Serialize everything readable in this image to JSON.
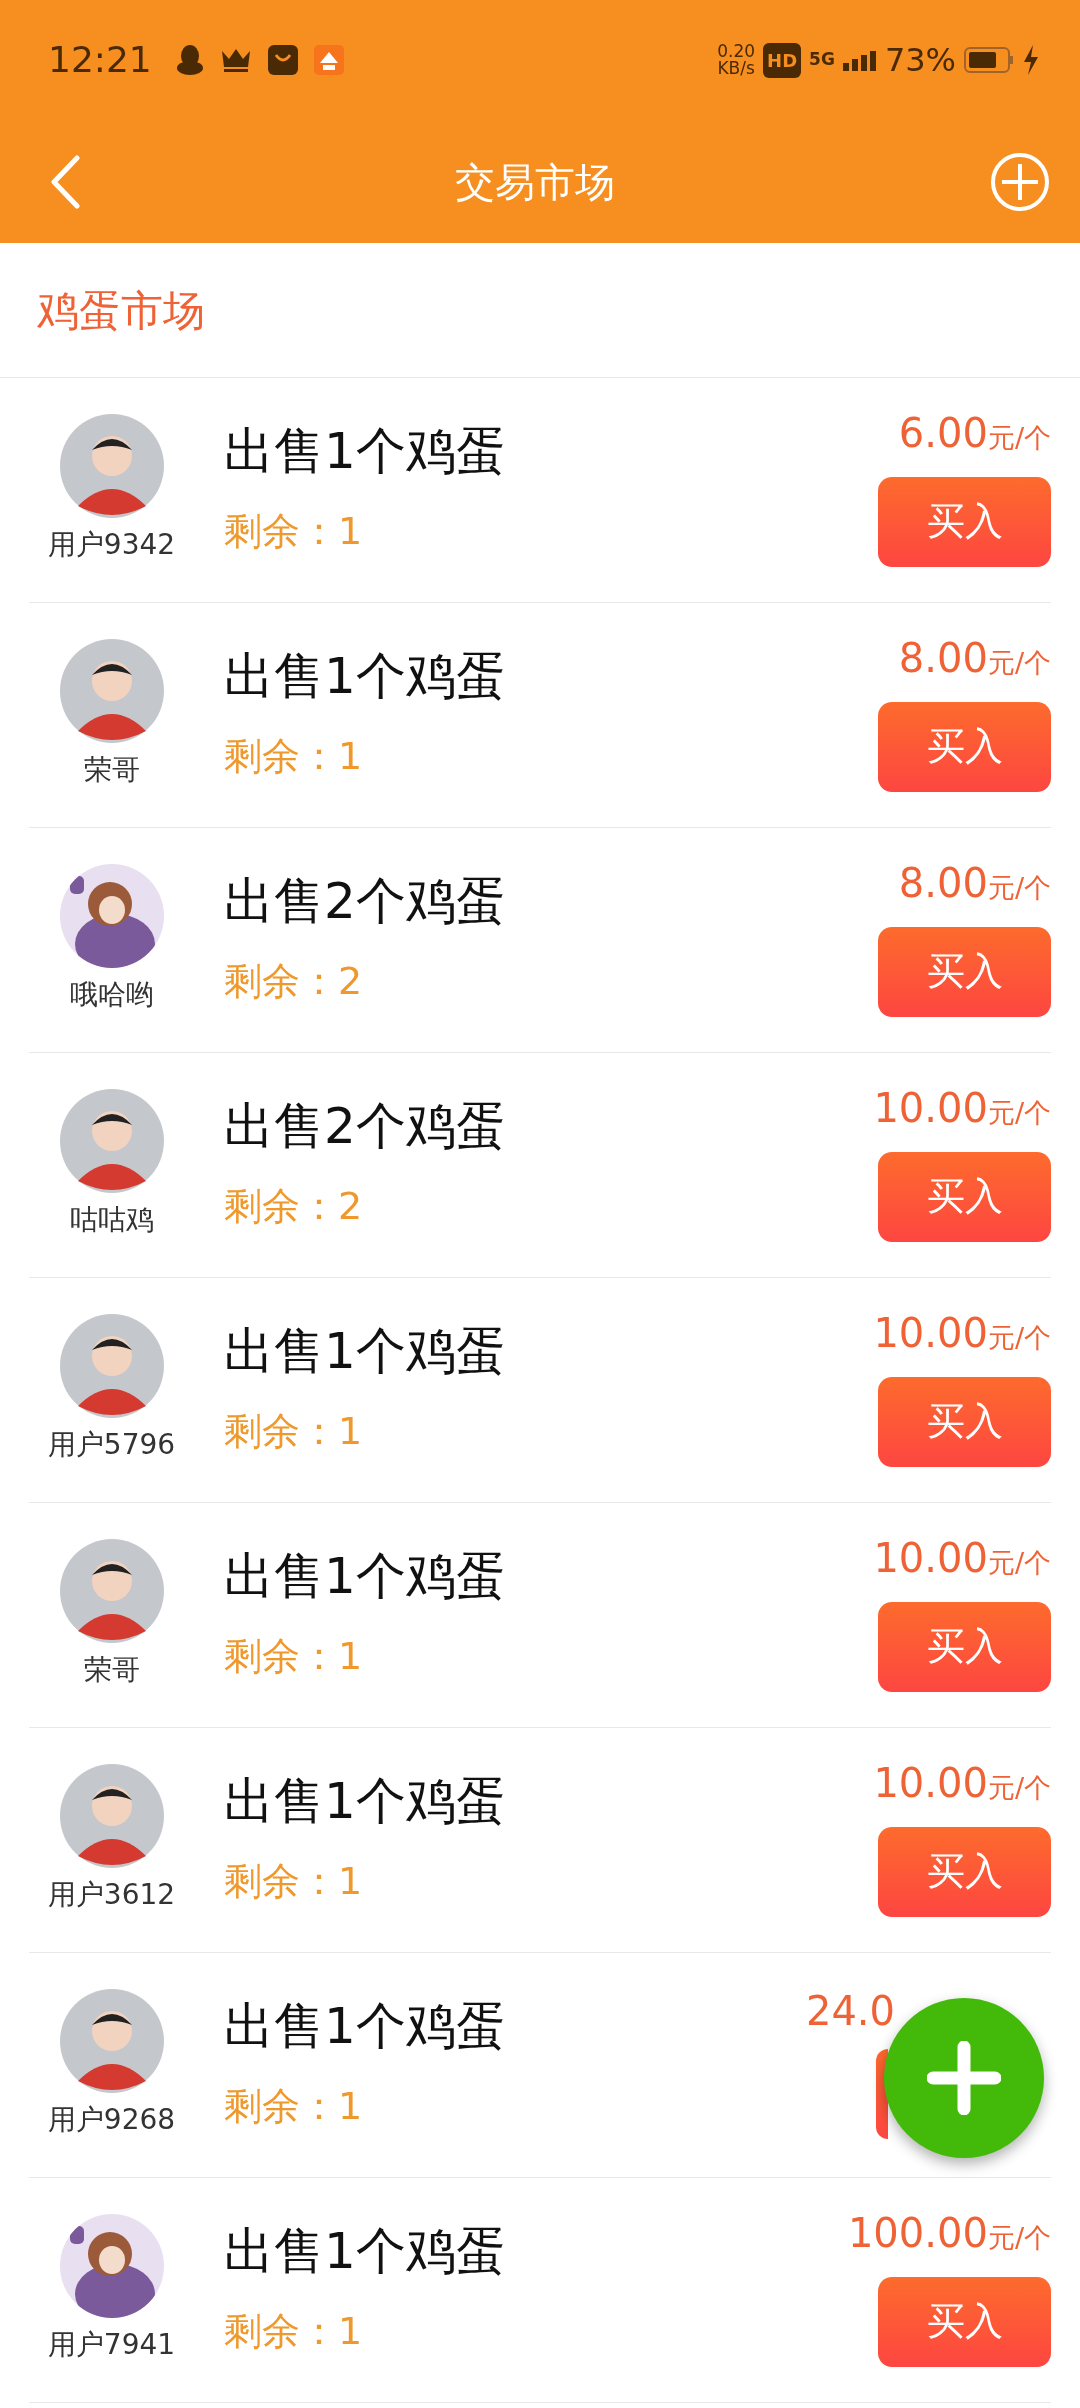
{
  "status_bar": {
    "time": "12:21",
    "speed": "0.20",
    "speed_unit": "KB/s",
    "hd": "HD",
    "network": "5G",
    "battery": "73%"
  },
  "header": {
    "title": "交易市场"
  },
  "section_title": "鸡蛋市场",
  "listings": [
    {
      "user": "用户9342",
      "avatar": {
        "kind": "default"
      },
      "title": "出售1个鸡蛋",
      "remaining": "剩余：1",
      "price": "6.00",
      "unit": "元/个",
      "button": "买入"
    },
    {
      "user": "荣哥",
      "avatar": {
        "kind": "default"
      },
      "title": "出售1个鸡蛋",
      "remaining": "剩余：1",
      "price": "8.00",
      "unit": "元/个",
      "button": "买入"
    },
    {
      "user": "哦哈哟",
      "title": "出售2个鸡蛋",
      "remaining": "剩余：2",
      "price": "8.00",
      "unit": "元/个",
      "button": "买入"
    },
    {
      "user": "咕咕鸡",
      "avatar": {
        "kind": "default"
      },
      "title": "出售2个鸡蛋",
      "remaining": "剩余：2",
      "price": "10.00",
      "unit": "元/个",
      "button": "买入"
    },
    {
      "user": "用户5796",
      "avatar": {
        "kind": "default"
      },
      "title": "出售1个鸡蛋",
      "remaining": "剩余：1",
      "price": "10.00",
      "unit": "元/个",
      "button": "买入"
    },
    {
      "user": "荣哥",
      "avatar": {
        "kind": "default"
      },
      "title": "出售1个鸡蛋",
      "remaining": "剩余：1",
      "price": "10.00",
      "unit": "元/个",
      "button": "买入"
    },
    {
      "user": "用户3612",
      "avatar": {
        "kind": "default"
      },
      "title": "出售1个鸡蛋",
      "remaining": "剩余：1",
      "price": "10.00",
      "unit": "元/个",
      "button": "买入"
    },
    {
      "user": "用户9268",
      "avatar": {
        "kind": "default"
      },
      "title": "出售1个鸡蛋",
      "remaining": "剩余：1",
      "price": "24.0"
    },
    {
      "user": "用户7941",
      "title": "出售1个鸡蛋",
      "remaining": "剩余：1",
      "price": "100.00",
      "unit": "元/个",
      "button": "买入"
    }
  ]
}
